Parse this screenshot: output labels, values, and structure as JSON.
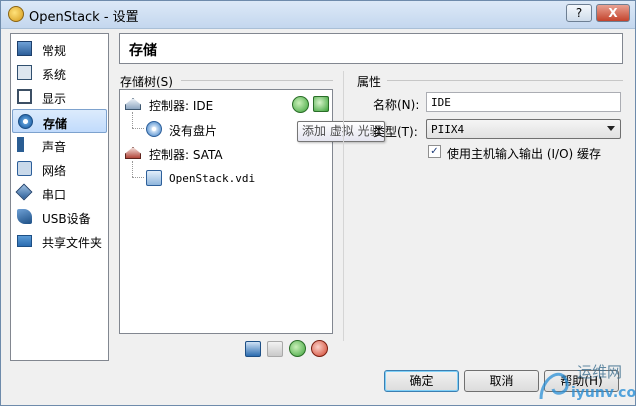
{
  "window": {
    "title": "OpenStack - 设置",
    "help_label": "?",
    "close_label": "X"
  },
  "sidebar": {
    "items": [
      {
        "label": "常规",
        "icon": "general-icon"
      },
      {
        "label": "系统",
        "icon": "system-icon"
      },
      {
        "label": "显示",
        "icon": "display-icon"
      },
      {
        "label": "存储",
        "icon": "storage-icon",
        "selected": true
      },
      {
        "label": "声音",
        "icon": "audio-icon"
      },
      {
        "label": "网络",
        "icon": "network-icon"
      },
      {
        "label": "串口",
        "icon": "serial-port-icon"
      },
      {
        "label": "USB设备",
        "icon": "usb-icon"
      },
      {
        "label": "共享文件夹",
        "icon": "shared-folder-icon"
      }
    ]
  },
  "page": {
    "title": "存储"
  },
  "storage_tree": {
    "label": "存储树(S)",
    "controllers": [
      {
        "label": "控制器: IDE",
        "children": [
          {
            "label": "没有盘片",
            "type": "optical"
          }
        ]
      },
      {
        "label": "控制器: SATA",
        "children": [
          {
            "label": "OpenStack.vdi",
            "type": "disk"
          }
        ]
      }
    ],
    "tooltip": "添加 虚拟 光驱"
  },
  "properties": {
    "label": "属性",
    "name_label": "名称(N):",
    "name_value": "IDE",
    "type_label": "类型(T):",
    "type_value": "PIIX4",
    "host_cache_label": "使用主机输入输出 (I/O) 缓存",
    "host_cache_checked": true
  },
  "buttons": {
    "ok": "确定",
    "cancel": "取消",
    "help": "帮助(H)"
  },
  "watermark": {
    "line1": "运维网",
    "line2": "iyunv.com"
  },
  "colors": {
    "accent": "#3c7fb1",
    "selection": "#c1dbfc",
    "titlebar": "#c4d7ee"
  }
}
